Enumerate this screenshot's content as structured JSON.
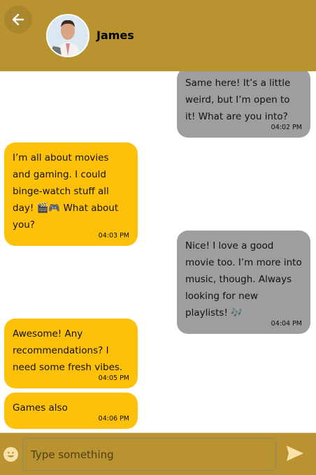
{
  "header": {
    "contact_name": "James"
  },
  "messages": [
    {
      "direction": "out",
      "text": "Same here! It’s a little weird, but I’m open to it! What are you into?",
      "time": "04:02 PM"
    },
    {
      "direction": "in",
      "text": "I’m all about movies and gaming. I could binge-watch stuff all day! 🎬🎮 What about you?",
      "time": "04:03 PM"
    },
    {
      "direction": "out",
      "text": "Nice! I love a good movie too. I’m more into music, though. Always looking for new playlists! 🎶",
      "time": "04:04 PM"
    },
    {
      "direction": "in",
      "text": "Awesome! Any recommendations? I need some fresh vibes.",
      "time": "04:05 PM"
    },
    {
      "direction": "in",
      "text": "Games also",
      "time": "04:06 PM"
    }
  ],
  "composer": {
    "placeholder": "Type something",
    "value": ""
  },
  "colors": {
    "header": "#b99330",
    "incoming": "#fdc109",
    "outgoing": "#9e9e9e"
  }
}
